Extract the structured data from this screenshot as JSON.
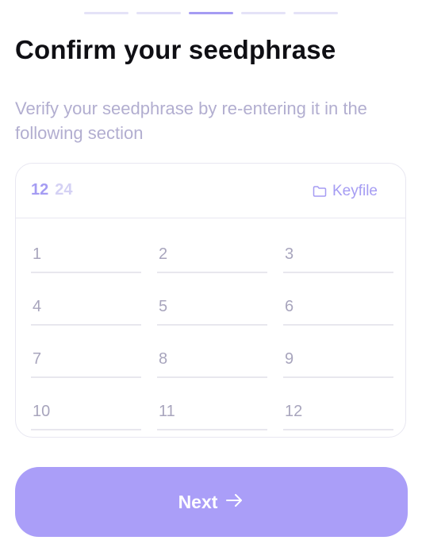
{
  "progress": {
    "steps": 5,
    "active_index": 2
  },
  "header": {
    "title": "Confirm your seedphrase"
  },
  "subtitle": "Verify your seedphrase by re-entering it in the following section",
  "seed_length": {
    "options": [
      "12",
      "24"
    ],
    "selected": "12"
  },
  "keyfile": {
    "label": "Keyfile",
    "icon": "folder-icon"
  },
  "fields": [
    {
      "number": "1"
    },
    {
      "number": "2"
    },
    {
      "number": "3"
    },
    {
      "number": "4"
    },
    {
      "number": "5"
    },
    {
      "number": "6"
    },
    {
      "number": "7"
    },
    {
      "number": "8"
    },
    {
      "number": "9"
    },
    {
      "number": "10"
    },
    {
      "number": "11"
    },
    {
      "number": "12"
    }
  ],
  "next_button": {
    "label": "Next",
    "icon": "arrow-right-icon"
  },
  "colors": {
    "accent": "#a59cf3",
    "button": "#aa9ef8",
    "subtitle": "#b2aed0"
  }
}
